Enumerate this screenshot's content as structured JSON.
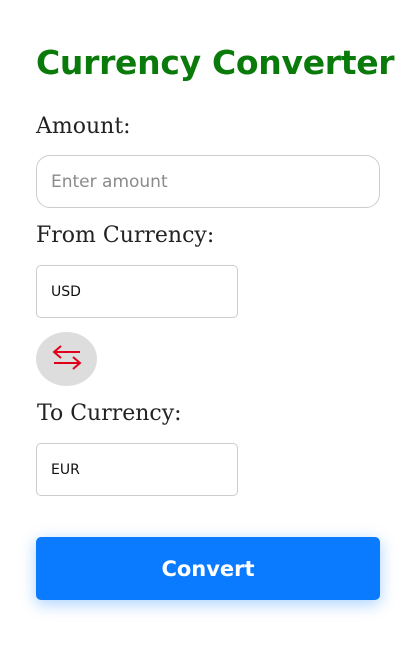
{
  "app": {
    "title": "Currency Converter"
  },
  "form": {
    "amount_label": "Amount:",
    "amount_value": "",
    "amount_placeholder": "Enter amount",
    "from_label": "From Currency:",
    "from_selected": "USD",
    "to_label": "To Currency:",
    "to_selected": "EUR",
    "swap_icon": "swap-arrows-icon",
    "convert_label": "Convert"
  },
  "colors": {
    "title": "#0a7a0a",
    "primary_button": "#0a7bff",
    "swap_icon": "#e0001b",
    "swap_bg": "#dddddd"
  }
}
